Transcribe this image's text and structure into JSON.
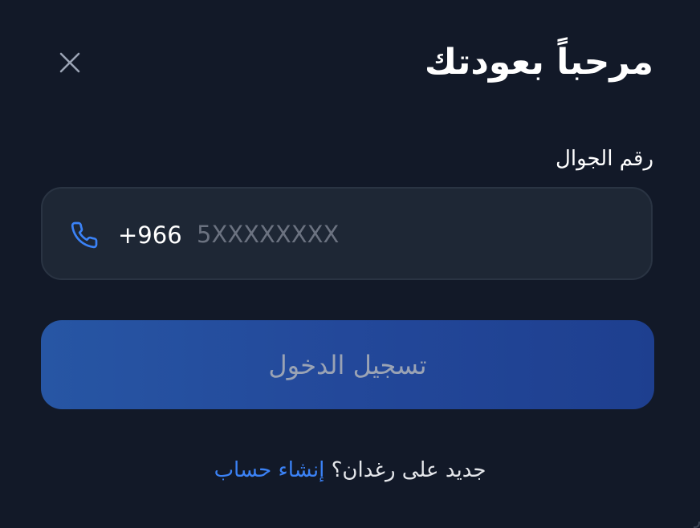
{
  "modal": {
    "title": "مرحباً بعودتك",
    "close_icon": "close-icon"
  },
  "phone": {
    "label": "رقم الجوال",
    "icon": "phone-icon",
    "country_code": "+966",
    "placeholder": "5XXXXXXXX",
    "value": ""
  },
  "login_button": {
    "label": "تسجيل الدخول"
  },
  "signup": {
    "prompt": "جديد على رغدان؟",
    "link_label": "إنشاء حساب"
  },
  "colors": {
    "background": "#121928",
    "field_background": "#1e2735",
    "button_gradient_start": "#2756a4",
    "button_gradient_end": "#1e3f8f",
    "accent": "#3b82f6",
    "muted_text": "#9aa3b4"
  }
}
